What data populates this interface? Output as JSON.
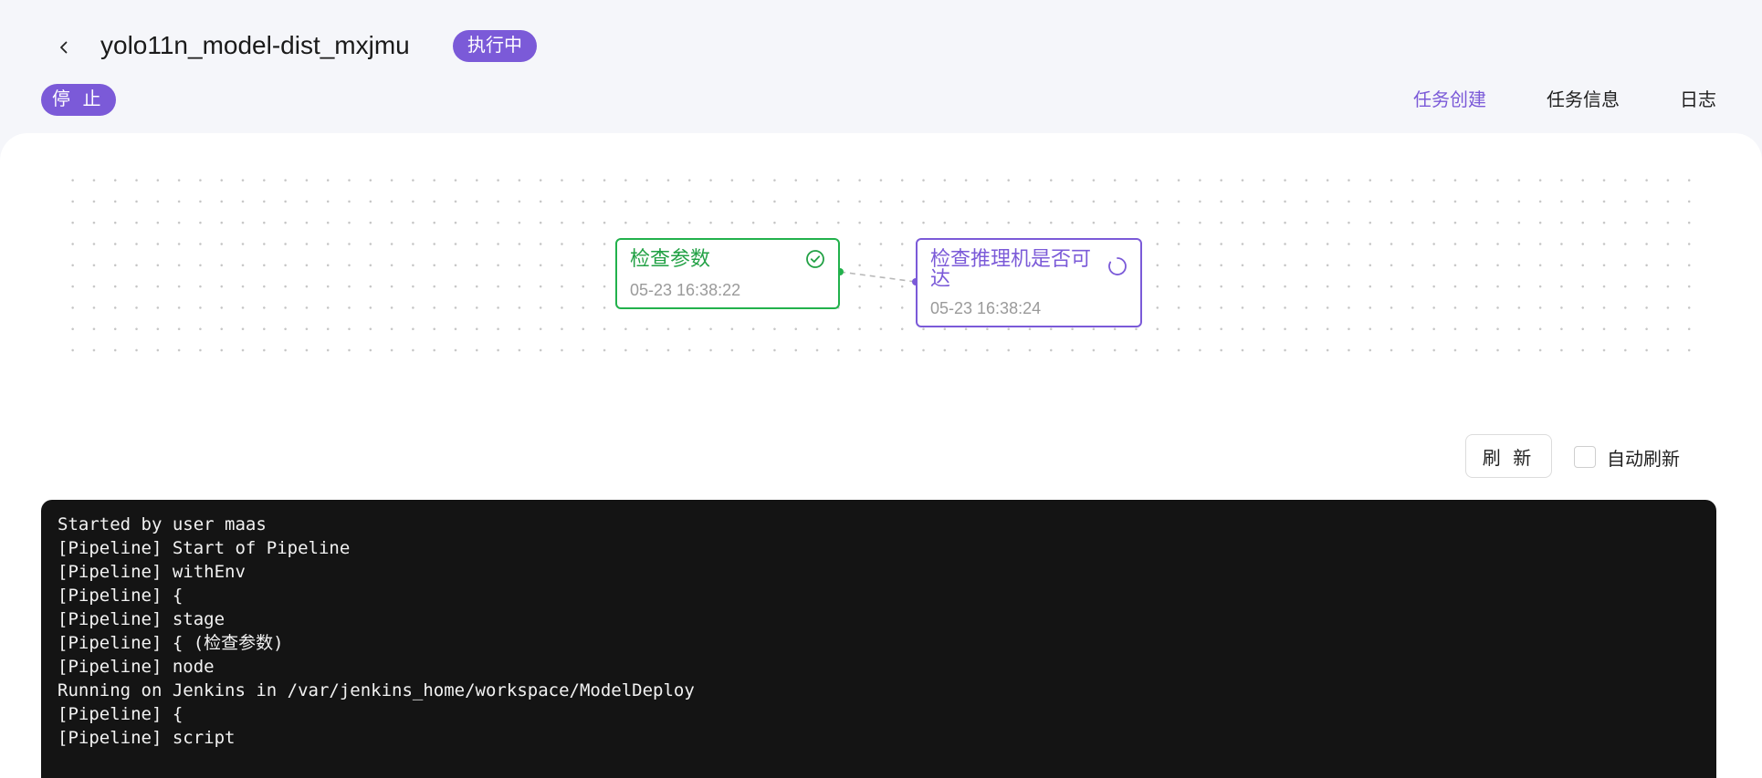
{
  "header": {
    "title": "yolo11n_model-dist_mxjmu",
    "status": "执行中",
    "stop_label": "停 止"
  },
  "tabs": [
    {
      "label": "任务创建",
      "active": true
    },
    {
      "label": "任务信息",
      "active": false
    },
    {
      "label": "日志",
      "active": false
    }
  ],
  "pipeline": {
    "nodes": [
      {
        "title": "检查参数",
        "time": "05-23 16:38:22",
        "status": "success",
        "icon": "check-circle-icon"
      },
      {
        "title": "检查推理机是否可达",
        "time": "05-23 16:38:24",
        "status": "running",
        "icon": "loading-spinner-icon"
      }
    ]
  },
  "controls": {
    "refresh_label": "刷 新",
    "auto_refresh_label": "自动刷新",
    "auto_refresh_checked": false
  },
  "log": {
    "lines": [
      "Started by user maas",
      "[Pipeline] Start of Pipeline",
      "[Pipeline] withEnv",
      "[Pipeline] {",
      "[Pipeline] stage",
      "[Pipeline] { (检查参数)",
      "[Pipeline] node",
      "Running on Jenkins in /var/jenkins_home/workspace/ModelDeploy",
      "[Pipeline] {",
      "[Pipeline] script"
    ]
  },
  "colors": {
    "accent": "#7b5ad8",
    "success": "#22b14c",
    "log_background": "#141414"
  }
}
